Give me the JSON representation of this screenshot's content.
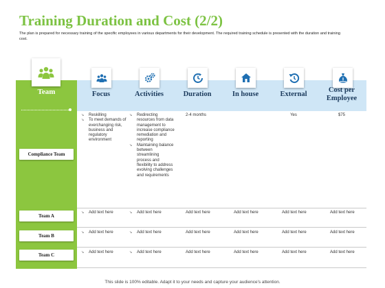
{
  "slide": {
    "title": "Training Duration and Cost (2/2)",
    "subtitle": "The plan is prepared  for necessary training of the specific employees in various departments for their development. The required training schedule is presented with the duration and training cost.",
    "footer": "This slide is 100% editable. Adapt it to your needs and capture your audience's attention."
  },
  "header": {
    "team": {
      "label": "Team",
      "icon": "team-group-icon"
    },
    "columns": [
      {
        "label": "Focus",
        "icon": "people-group-icon"
      },
      {
        "label": "Activities",
        "icon": "gears-icon"
      },
      {
        "label": "Duration",
        "icon": "clock-icon"
      },
      {
        "label": "In house",
        "icon": "house-icon"
      },
      {
        "label": "External",
        "icon": "refresh-icon"
      },
      {
        "label": "Cost per Employee",
        "icon": "money-bag-icon"
      }
    ]
  },
  "colors": {
    "green": "#8cc63f",
    "title_green": "#7cc242",
    "band_blue": "#cfe6f6",
    "icon_blue": "#1f6fb2"
  },
  "rows": [
    {
      "team": "Compliance Team",
      "focus": [
        "Reskilling",
        "To meet demands of everchanging risk, business and regulatory environment"
      ],
      "activities": [
        "Redirecting resources from data management to increase compliance remediation and reporting",
        "Maintaining balance between streamlining process and flexibility to address evolving challenges and requirements"
      ],
      "duration": "2-4 months",
      "in_house": "",
      "external": "Yes",
      "cost": "$75"
    },
    {
      "team": "Team A",
      "focus": "Add text here",
      "activities": "Add text here",
      "duration": "Add text here",
      "in_house": "Add text here",
      "external": "Add text here",
      "cost": "Add text here"
    },
    {
      "team": "Team B",
      "focus": "Add text here",
      "activities": "Add text here",
      "duration": "Add text here",
      "in_house": "Add text here",
      "external": "Add text here",
      "cost": "Add text here"
    },
    {
      "team": "Team C",
      "focus": "Add text here",
      "activities": "Add text here",
      "duration": "Add text here",
      "in_house": "Add text here",
      "external": "Add text here",
      "cost": "Add text here"
    }
  ]
}
